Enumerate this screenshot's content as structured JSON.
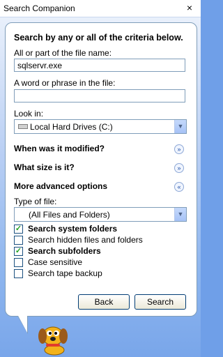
{
  "window": {
    "title": "Search Companion",
    "close": "×"
  },
  "search": {
    "heading": "Search by any or all of the criteria below.",
    "file_name_label": "All or part of the file name:",
    "file_name_value": "sqlservr.exe",
    "phrase_label": "A word or phrase in the file:",
    "phrase_value": "",
    "look_in_label": "Look in:",
    "look_in_value": "Local Hard Drives (C:)",
    "modified_label": "When was it modified?",
    "size_label": "What size is it?",
    "advanced_label": "More advanced options",
    "type_label": "Type of file:",
    "type_value": "(All Files and Folders)",
    "options": [
      {
        "label": "Search system folders",
        "checked": true,
        "bold": true
      },
      {
        "label": "Search hidden files and folders",
        "checked": false,
        "bold": false
      },
      {
        "label": "Search subfolders",
        "checked": true,
        "bold": true
      },
      {
        "label": "Case sensitive",
        "checked": false,
        "bold": false
      },
      {
        "label": "Search tape backup",
        "checked": false,
        "bold": false
      }
    ],
    "back_button": "Back",
    "search_button": "Search"
  },
  "icons": {
    "close": "close-icon",
    "drive": "hard-drive-icon",
    "dropdown": "chevron-down-icon",
    "expand": "double-chevron-down-icon",
    "collapse": "double-chevron-up-icon",
    "check": "checkmark-icon",
    "companion": "search-dog-icon"
  },
  "colors": {
    "accent": "#6f9fe8",
    "panel_border": "#7f9db9",
    "check_green": "#21a121",
    "dog_body": "#f2b21b",
    "dog_collar": "#e23b2c"
  }
}
